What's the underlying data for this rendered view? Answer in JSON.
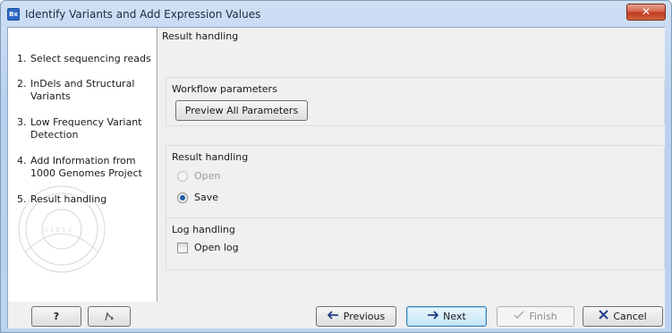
{
  "window": {
    "app_icon_text": "Bx",
    "title": "Identify Variants and Add Expression Values",
    "close_glyph": "✕"
  },
  "steps": [
    {
      "num": "1.",
      "label": "Select sequencing reads"
    },
    {
      "num": "2.",
      "label": "InDels and Structural Variants"
    },
    {
      "num": "3.",
      "label": "Low Frequency Variant Detection"
    },
    {
      "num": "4.",
      "label": "Add Information from 1000 Genomes Project"
    },
    {
      "num": "5.",
      "label": "Result handling"
    }
  ],
  "main": {
    "page_title": "Result handling",
    "workflow_group": {
      "label": "Workflow parameters",
      "preview_button": "Preview All Parameters"
    },
    "result_group": {
      "label": "Result handling",
      "options": [
        {
          "label": "Open",
          "checked": false,
          "enabled": false
        },
        {
          "label": "Save",
          "checked": true,
          "enabled": true
        }
      ]
    },
    "log_group": {
      "label": "Log handling",
      "open_log_label": "Open log",
      "open_log_checked": false
    }
  },
  "footer": {
    "help_label": "?",
    "reset_icon": "reset-icon",
    "previous_label": "Previous",
    "next_label": "Next",
    "finish_label": "Finish",
    "cancel_label": "Cancel"
  },
  "colors": {
    "title_bar": "#b9d1ee",
    "close_button": "#c0391f",
    "focus_border": "#3c7fb1",
    "radio_selected": "#1f5fa8",
    "cancel_x": "#1f3f8a",
    "arrow": "#1f3f8a"
  }
}
